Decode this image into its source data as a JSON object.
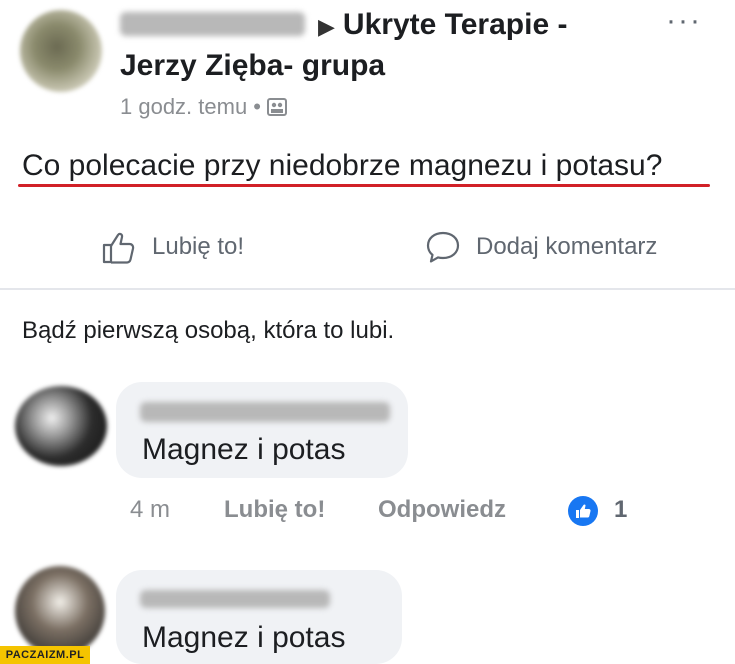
{
  "post": {
    "group_line1": "Ukryte Terapie -",
    "group_line2": "Jerzy Zięba- grupa",
    "time": "1 godz. temu",
    "separator": "•",
    "more": "···",
    "question": "Co polecacie przy niedobrze magnezu i potasu?",
    "actions": {
      "like": "Lubię to!",
      "comment": "Dodaj komentarz"
    },
    "first_like": "Bądź pierwszą osobą, która to lubi."
  },
  "comments": [
    {
      "text": "Magnez i potas",
      "time": "4 m",
      "like": "Lubię to!",
      "reply": "Odpowiedz",
      "reactions": "1"
    },
    {
      "text": "Magnez i potas"
    }
  ],
  "watermark": "PACZAIZM.PL",
  "colors": {
    "accent_blue": "#1877f2",
    "underline_red": "#d12027",
    "muted": "#8a8d91",
    "bubble": "#f0f2f5"
  }
}
